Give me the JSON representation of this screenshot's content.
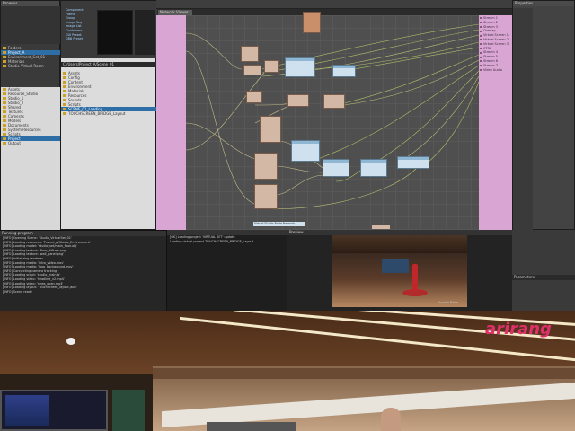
{
  "left_panel": {
    "title": "Browser",
    "tree_items": [
      {
        "label": "Folders",
        "selected": false
      },
      {
        "label": "Project_A",
        "selected": true
      },
      {
        "label": "Environment_Set_01",
        "selected": false
      },
      {
        "label": "Materials",
        "selected": false
      },
      {
        "label": "Studio Virtual Room",
        "selected": false
      }
    ],
    "lower_items": [
      {
        "label": "Assets",
        "selected": false
      },
      {
        "label": "Resource_Studio",
        "selected": false
      },
      {
        "label": "Studio_1",
        "selected": false
      },
      {
        "label": "Studio_2",
        "selected": false
      },
      {
        "label": "Shared",
        "selected": false
      },
      {
        "label": "Textures",
        "selected": false
      },
      {
        "label": "Cameras",
        "selected": false
      },
      {
        "label": "Models",
        "selected": false
      },
      {
        "label": "Documents",
        "selected": false
      },
      {
        "label": "System Resources",
        "selected": false
      },
      {
        "label": "Scripts",
        "selected": false
      },
      {
        "label": "Project",
        "selected": true
      },
      {
        "label": "Output",
        "selected": false
      }
    ]
  },
  "middle_panel": {
    "legend_items": [
      "Component",
      "Frame",
      "Group",
      "Image Seq",
      "Image List",
      "Containers",
      "GUI Preset",
      "DBB Preset"
    ],
    "file_path": "C:/Users/Project_A/Scene_01",
    "file_items": [
      {
        "label": "Assets",
        "selected": false
      },
      {
        "label": "Config",
        "selected": false
      },
      {
        "label": "Content",
        "selected": false
      },
      {
        "label": "Environment",
        "selected": false
      },
      {
        "label": "Materials",
        "selected": false
      },
      {
        "label": "Resources",
        "selected": false
      },
      {
        "label": "Sounds",
        "selected": false
      },
      {
        "label": "Scripts",
        "selected": false
      },
      {
        "label": "SCENE_01_Loading",
        "selected": true
      },
      {
        "label": "TOUCHSCREEN_BRIDGE_Layout",
        "selected": false
      }
    ]
  },
  "node_editor": {
    "tab_label": "Network Viewer",
    "bottom_tag": "Virtual Studio Node Network",
    "right_ports": [
      "Stream 1",
      "Stream 2",
      "Stream 3",
      "Overlay",
      "Virtual Screen 1",
      "Virtual Screen 2",
      "Virtual Screen 3",
      "CTRL",
      "Stream 4",
      "Stream 5",
      "Stream 6",
      "Stream 7",
      "Video Audio"
    ],
    "left_ports": [
      "Input"
    ]
  },
  "log_panel": {
    "header": "Running program",
    "lines": [
      "[INFO] Opening Scene: 'Studio_VirtualSet_01'",
      "[INFO] Loading resources: 'Project_A/Studio_Environment'",
      "[INFO] Loading model: 'studio_set/main_floor.obj'",
      "[INFO] Loading texture: 'floor_diffuse.png'",
      "[INFO] Loading texture: 'wall_panel.png'",
      "[INFO] Initializing renderer",
      "[INFO] Loading media: 'intro_video.mov'",
      "[INFO] Loading media: 'loop_background.mov'",
      "[INFO] Connecting camera tracking",
      "[INFO] Loading script: 'studio_main.js'",
      "[INFO] Loading video: 'headline_v2.mp4'",
      "[INFO] Loading video: 'news_open.mp4'",
      "[INFO] Loading layout: 'TouchScreen_layout.json'",
      "[INFO] Scene ready"
    ]
  },
  "console_panel": {
    "lines": [
      "[OK] Loading project 'VIRTUAL SET' update",
      "Loading virtual project TOUCHSCREEN_BRIDGE_Layout"
    ]
  },
  "preview_panel": {
    "label": "Preview",
    "watermark": "Aspect Ratio"
  },
  "right_panel": {
    "title": "Properties",
    "footer": "Parameters"
  },
  "broadcast": {
    "logo": "arirang"
  }
}
